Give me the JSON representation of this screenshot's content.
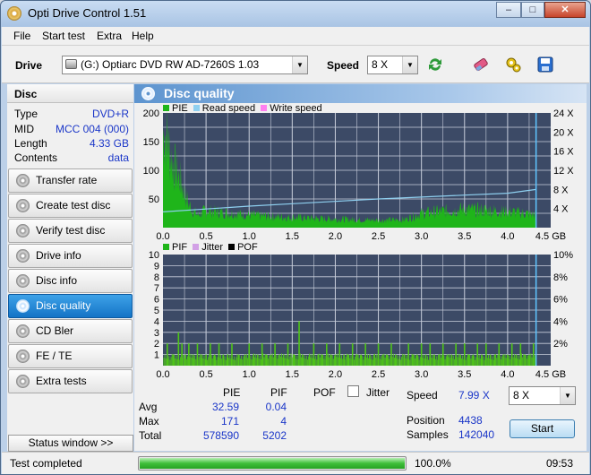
{
  "window": {
    "title": "Opti Drive Control 1.51",
    "minimize": "–",
    "maximize": "□",
    "close": "✕"
  },
  "menu": [
    "File",
    "Start test",
    "Extra",
    "Help"
  ],
  "toolbar": {
    "drive_label": "Drive",
    "drive_value": "(G:)  Optiarc DVD RW AD-7260S 1.03",
    "speed_label": "Speed",
    "speed_value": "8 X"
  },
  "disc": {
    "header": "Disc",
    "rows": [
      {
        "label": "Type",
        "value": "DVD+R"
      },
      {
        "label": "MID",
        "value": "MCC 004 (000)"
      },
      {
        "label": "Length",
        "value": "4.33 GB"
      },
      {
        "label": "Contents",
        "value": "data"
      }
    ]
  },
  "nav": [
    {
      "label": "Transfer rate",
      "active": false
    },
    {
      "label": "Create test disc",
      "active": false
    },
    {
      "label": "Verify test disc",
      "active": false
    },
    {
      "label": "Drive info",
      "active": false
    },
    {
      "label": "Disc info",
      "active": false
    },
    {
      "label": "Disc quality",
      "active": true
    },
    {
      "label": "CD Bler",
      "active": false
    },
    {
      "label": "FE / TE",
      "active": false
    },
    {
      "label": "Extra tests",
      "active": false
    }
  ],
  "status_window_label": "Status window >>",
  "panel_title": "Disc quality",
  "chart_data": [
    {
      "type": "area",
      "legend": [
        "PIE",
        "Read speed",
        "Write speed"
      ],
      "colors": {
        "PIE": "#1fb51a",
        "Read speed": "#8fd0f0",
        "Write speed": "#ff7ff0"
      },
      "x_ticks": [
        "0.0",
        "0.5",
        "1.0",
        "1.5",
        "2.0",
        "2.5",
        "3.0",
        "3.5",
        "4.0",
        "4.5 GB"
      ],
      "y_left_ticks": [
        "200",
        "150",
        "100",
        "50"
      ],
      "y_right_ticks": [
        "24 X",
        "20 X",
        "16 X",
        "12 X",
        "8 X",
        "4 X"
      ],
      "xlim": [
        0,
        4.5
      ],
      "ylim": [
        0,
        200
      ],
      "y2lim": [
        0,
        24
      ],
      "pie_profile": [
        [
          0,
          160
        ],
        [
          0.02,
          170
        ],
        [
          0.05,
          150
        ],
        [
          0.1,
          120
        ],
        [
          0.15,
          100
        ],
        [
          0.2,
          85
        ],
        [
          0.25,
          60
        ],
        [
          0.3,
          40
        ],
        [
          0.35,
          30
        ],
        [
          0.4,
          22
        ],
        [
          0.5,
          30
        ],
        [
          0.6,
          28
        ],
        [
          0.8,
          25
        ],
        [
          1.0,
          22
        ],
        [
          1.2,
          20
        ],
        [
          1.5,
          18
        ],
        [
          1.8,
          16
        ],
        [
          2.0,
          15
        ],
        [
          2.2,
          14
        ],
        [
          2.5,
          13
        ],
        [
          2.8,
          14
        ],
        [
          3.0,
          25
        ],
        [
          3.2,
          28
        ],
        [
          3.5,
          32
        ],
        [
          3.8,
          30
        ],
        [
          4.0,
          28
        ],
        [
          4.2,
          25
        ],
        [
          4.33,
          22
        ]
      ],
      "read_speed_profile": [
        [
          0,
          3.3
        ],
        [
          0.5,
          3.9
        ],
        [
          1.0,
          4.5
        ],
        [
          1.5,
          5.0
        ],
        [
          2.0,
          5.5
        ],
        [
          2.5,
          6.0
        ],
        [
          3.0,
          6.4
        ],
        [
          3.5,
          6.8
        ],
        [
          4.0,
          7.2
        ],
        [
          4.33,
          7.99
        ]
      ],
      "end_marker": 4.33
    },
    {
      "type": "bar",
      "legend": [
        "PIF",
        "Jitter",
        "POF"
      ],
      "colors": {
        "PIF": "#4fc518",
        "Jitter": "#d2a0e6",
        "POF": "#000000"
      },
      "x_ticks": [
        "0.0",
        "0.5",
        "1.0",
        "1.5",
        "2.0",
        "2.5",
        "3.0",
        "3.5",
        "4.0",
        "4.5 GB"
      ],
      "y_left_ticks": [
        "10",
        "9",
        "8",
        "7",
        "6",
        "5",
        "4",
        "3",
        "2",
        "1"
      ],
      "y_right_ticks": [
        "10%",
        "8%",
        "6%",
        "4%",
        "2%"
      ],
      "xlim": [
        0,
        4.5
      ],
      "ylim": [
        0,
        10
      ],
      "y2lim": [
        0,
        10
      ],
      "pif_spikes": [
        [
          0.05,
          2
        ],
        [
          0.12,
          1
        ],
        [
          0.18,
          3
        ],
        [
          0.22,
          2
        ],
        [
          0.26,
          1
        ],
        [
          0.3,
          2
        ],
        [
          0.35,
          1
        ],
        [
          0.4,
          2
        ],
        [
          0.45,
          1
        ],
        [
          0.5,
          1
        ],
        [
          0.55,
          2
        ],
        [
          0.6,
          1
        ],
        [
          0.65,
          2
        ],
        [
          0.7,
          1
        ],
        [
          0.75,
          1
        ],
        [
          0.8,
          2
        ],
        [
          0.88,
          1
        ],
        [
          0.95,
          1
        ],
        [
          1.0,
          2
        ],
        [
          1.05,
          1
        ],
        [
          1.1,
          1
        ],
        [
          1.15,
          2
        ],
        [
          1.2,
          1
        ],
        [
          1.25,
          1
        ],
        [
          1.3,
          2
        ],
        [
          1.35,
          1
        ],
        [
          1.4,
          1
        ],
        [
          1.45,
          2
        ],
        [
          1.52,
          1
        ],
        [
          1.58,
          4
        ],
        [
          1.62,
          1
        ],
        [
          1.7,
          1
        ],
        [
          1.75,
          2
        ],
        [
          1.8,
          1
        ],
        [
          1.85,
          1
        ],
        [
          1.9,
          2
        ],
        [
          1.95,
          1
        ],
        [
          2.0,
          1
        ],
        [
          2.05,
          2
        ],
        [
          2.1,
          1
        ],
        [
          2.15,
          1
        ],
        [
          2.2,
          2
        ],
        [
          2.25,
          1
        ],
        [
          2.3,
          1
        ],
        [
          2.35,
          2
        ],
        [
          2.4,
          1
        ],
        [
          2.45,
          1
        ],
        [
          2.5,
          2
        ],
        [
          2.55,
          1
        ],
        [
          2.6,
          1
        ],
        [
          2.65,
          2
        ],
        [
          2.7,
          1
        ],
        [
          2.8,
          1
        ],
        [
          2.85,
          2
        ],
        [
          2.9,
          1
        ],
        [
          2.95,
          1
        ],
        [
          3.0,
          2
        ],
        [
          3.05,
          1
        ],
        [
          3.1,
          2
        ],
        [
          3.15,
          1
        ],
        [
          3.2,
          1
        ],
        [
          3.25,
          2
        ],
        [
          3.3,
          1
        ],
        [
          3.35,
          1
        ],
        [
          3.4,
          2
        ],
        [
          3.45,
          1
        ],
        [
          3.5,
          2
        ],
        [
          3.55,
          1
        ],
        [
          3.6,
          1
        ],
        [
          3.65,
          2
        ],
        [
          3.7,
          1
        ],
        [
          3.75,
          2
        ],
        [
          3.8,
          1
        ],
        [
          3.85,
          1
        ],
        [
          3.9,
          2
        ],
        [
          3.95,
          1
        ],
        [
          4.0,
          1
        ],
        [
          4.05,
          2
        ],
        [
          4.1,
          1
        ],
        [
          4.15,
          2
        ],
        [
          4.2,
          1
        ],
        [
          4.25,
          1
        ],
        [
          4.3,
          2
        ]
      ],
      "end_marker": 4.33
    }
  ],
  "stats": {
    "cols": [
      "PIE",
      "PIF",
      "POF"
    ],
    "jitter_label": "Jitter",
    "rows": [
      {
        "label": "Avg",
        "pie": "32.59",
        "pif": "0.04"
      },
      {
        "label": "Max",
        "pie": "171",
        "pif": "4"
      },
      {
        "label": "Total",
        "pie": "578590",
        "pif": "5202"
      }
    ],
    "speed_label": "Speed",
    "speed_value": "7.99 X",
    "speed_select": "8 X",
    "position_label": "Position",
    "position_value": "4438",
    "samples_label": "Samples",
    "samples_value": "142040",
    "start_label": "Start"
  },
  "statusbar": {
    "text": "Test completed",
    "progress_percent": 100.0,
    "progress_label": "100.0%",
    "time": "09:53"
  }
}
